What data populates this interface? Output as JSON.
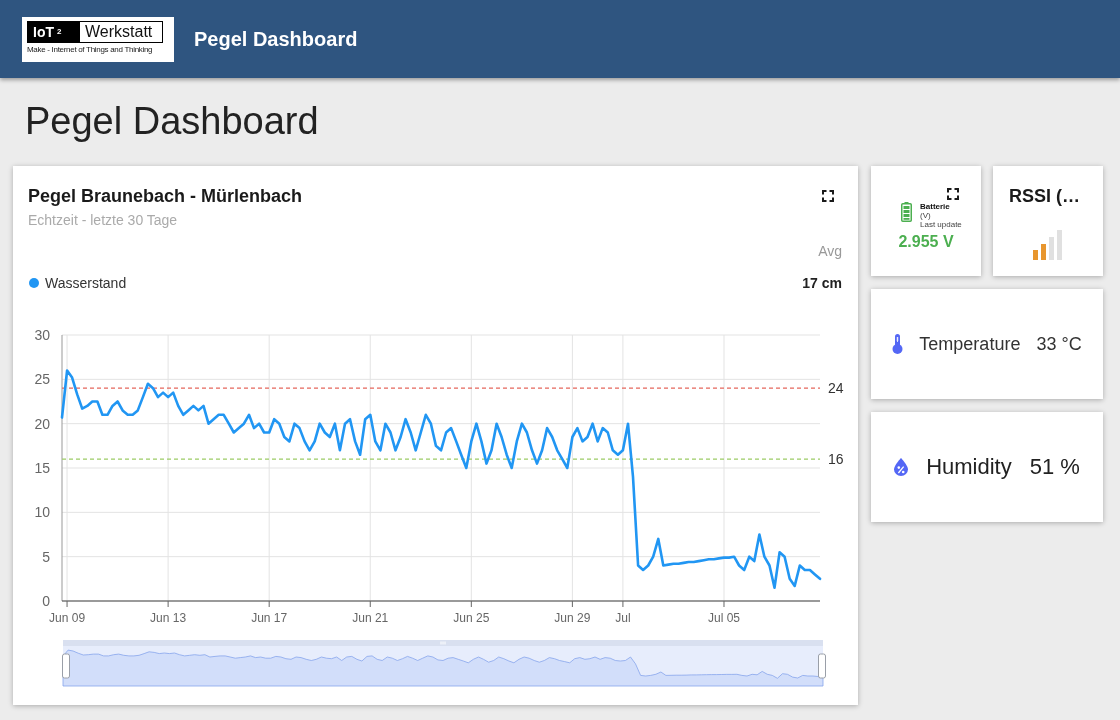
{
  "header": {
    "logo": {
      "brand": "IoT$^{2}$",
      "name": "Werkstatt",
      "tagline": "Make - Internet of Things and Thinking"
    },
    "title": "Pegel Dashboard"
  },
  "page_title": "Pegel Dashboard",
  "chart_card": {
    "title": "Pegel Braunebach - Mürlenbach",
    "subtitle": "Echtzeit - letzte 30 Tage",
    "legend": {
      "header": "Avg",
      "items": [
        {
          "value": "17 cm"
        }
      ]
    },
    "chart_data": {
      "type": "line",
      "grid": true,
      "categories": [
        null,
        "Jun 09",
        null,
        null,
        null,
        null,
        null,
        null,
        null,
        null,
        null,
        null,
        null,
        null,
        null,
        null,
        null,
        null,
        null,
        null,
        null,
        "Jun 13",
        null,
        null,
        null,
        null,
        null,
        null,
        null,
        null,
        null,
        null,
        null,
        null,
        null,
        null,
        null,
        null,
        null,
        null,
        null,
        "Jun 17",
        null,
        null,
        null,
        null,
        null,
        null,
        null,
        null,
        null,
        null,
        null,
        null,
        null,
        null,
        null,
        null,
        null,
        null,
        null,
        "Jun 21",
        null,
        null,
        null,
        null,
        null,
        null,
        null,
        null,
        null,
        null,
        null,
        null,
        null,
        null,
        null,
        null,
        null,
        null,
        null,
        "Jun 25",
        null,
        null,
        null,
        null,
        null,
        null,
        null,
        null,
        null,
        null,
        null,
        null,
        null,
        null,
        null,
        null,
        null,
        null,
        null,
        "Jun 29",
        null,
        null,
        null,
        null,
        null,
        null,
        null,
        null,
        null,
        "Jul",
        null,
        null,
        null,
        null,
        null,
        null,
        null,
        null,
        null,
        null,
        null,
        null,
        null,
        null,
        null,
        null,
        null,
        null,
        null,
        "Jul 05",
        null,
        null,
        null,
        null,
        null,
        null,
        null,
        null,
        null,
        null,
        null,
        null,
        null,
        null,
        null,
        null,
        null,
        null,
        null
      ],
      "series": [
        {
          "name": "Wasserstand",
          "color": "#2196f3",
          "values": [
            20.7,
            26,
            25.2,
            23.3,
            21.7,
            22,
            22.5,
            22.5,
            21,
            21,
            22,
            22.5,
            21.5,
            21,
            21,
            21.5,
            23,
            24.5,
            24,
            23,
            23.5,
            23,
            23.5,
            22,
            21,
            21.5,
            22,
            21.5,
            22,
            20,
            20.5,
            21,
            21,
            20,
            19,
            19.5,
            20,
            21,
            19.5,
            20,
            19,
            19,
            20.5,
            20,
            18.5,
            18,
            20,
            19.5,
            18,
            17,
            18,
            20,
            19,
            18.5,
            20,
            17,
            20,
            20.5,
            18,
            16.5,
            20.5,
            21,
            18,
            17,
            20,
            19,
            17,
            18.5,
            20.5,
            19,
            17,
            19,
            21,
            20,
            17.5,
            17,
            19,
            19.5,
            18,
            16.5,
            15,
            18,
            20,
            18,
            15.5,
            17,
            20,
            18.5,
            16.5,
            15,
            18,
            20,
            19,
            17,
            15.5,
            17,
            19.5,
            18.5,
            17,
            16,
            15,
            18.5,
            19.5,
            18,
            18.5,
            20,
            18,
            19.5,
            19,
            17,
            16.5,
            17,
            20,
            14,
            4,
            3.5,
            4,
            5,
            7,
            4,
            4.1,
            4.2,
            4.2,
            4.3,
            4.4,
            4.4,
            4.5,
            4.6,
            4.7,
            4.7,
            4.8,
            4.9,
            4.9,
            5,
            4,
            3.5,
            5,
            4.5,
            7.5,
            5,
            4,
            1.5,
            5.5,
            5,
            2.5,
            1.7,
            4,
            3.5,
            3.5,
            3,
            2.5
          ]
        }
      ],
      "ylim": [
        0,
        30
      ],
      "yticks": [
        0,
        5,
        10,
        15,
        20,
        25,
        30
      ],
      "ref_lines": [
        {
          "axis": "y",
          "value": 24,
          "label": "24",
          "color": "#e5675c"
        },
        {
          "axis": "y",
          "value": 16,
          "label": "16",
          "color": "#9ccc65"
        }
      ]
    }
  },
  "battery_card": {
    "title": "Batterie",
    "unit": "(V)",
    "caption": "Last update",
    "value": "2.955 V"
  },
  "rssi_card": {
    "title": "RSSI (…"
  },
  "sensor_cards": [
    {
      "kind": "temperature",
      "label": "Temperature",
      "value": "33 °C"
    },
    {
      "kind": "humidity",
      "label": "Humidity",
      "value": "51 %"
    }
  ]
}
